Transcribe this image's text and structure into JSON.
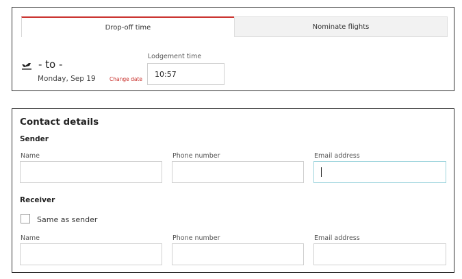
{
  "tabs": [
    {
      "label": "Drop-off time"
    },
    {
      "label": "Nominate flights"
    }
  ],
  "flight": {
    "route": "- to -",
    "date": "Monday, Sep 19",
    "change_label": "Change date",
    "lodgement_label": "Lodgement time",
    "lodgement_value": "10:57",
    "icon": "plane-departure-icon"
  },
  "contact": {
    "title": "Contact details",
    "sender": {
      "heading": "Sender",
      "name_label": "Name",
      "phone_label": "Phone number",
      "email_label": "Email address"
    },
    "receiver": {
      "heading": "Receiver",
      "same_as_sender": "Same as sender",
      "name_label": "Name",
      "phone_label": "Phone number",
      "email_label": "Email address"
    }
  },
  "colors": {
    "accent": "#c9302c",
    "focus": "#9bd3dc"
  }
}
